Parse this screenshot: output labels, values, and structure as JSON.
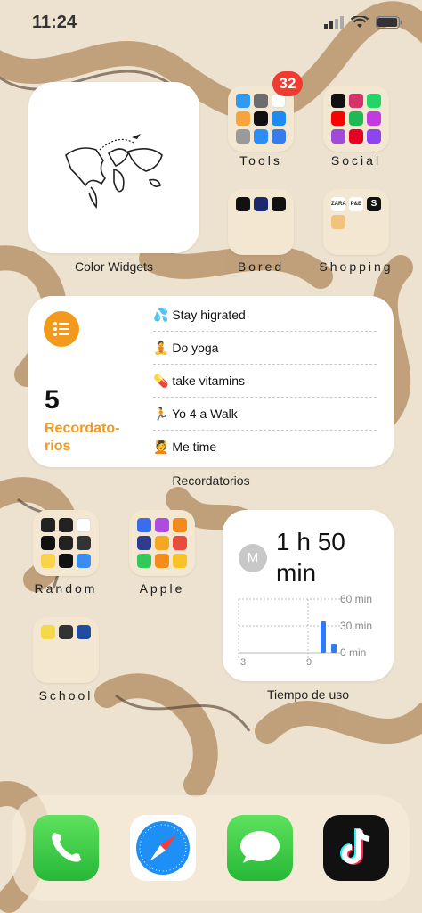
{
  "status": {
    "time": "11:24"
  },
  "widgets": {
    "color_widgets": {
      "label": "Color Widgets"
    },
    "reminders": {
      "count": "5",
      "title_line1": "Recordato-",
      "title_line2": "rios",
      "label": "Recordatorios",
      "items": [
        {
          "emoji": "💦",
          "text": "Stay higrated"
        },
        {
          "emoji": "🧘",
          "text": "Do yoga"
        },
        {
          "emoji": "💊",
          "text": "take vitamins"
        },
        {
          "emoji": "🏃",
          "text": "Yo 4 a Walk"
        },
        {
          "emoji": "💆",
          "text": "Me time"
        }
      ]
    },
    "screen_time": {
      "avatar": "M",
      "hours": "1 h 50",
      "minutes": "min",
      "label": "Tiempo de uso",
      "y_ticks": [
        "60 min",
        "30 min",
        "0 min"
      ],
      "x_ticks": [
        "3",
        "9"
      ],
      "bars_minutes": [
        35,
        10
      ],
      "accent": "#2f7cf6"
    }
  },
  "folders": {
    "tools": {
      "label": "Tools",
      "badge": "32"
    },
    "social": {
      "label": "Social"
    },
    "bored": {
      "label": "Bored"
    },
    "shopping": {
      "label": "Shopping",
      "zara": "ZARA",
      "pb": "P&B",
      "s": "S"
    },
    "random": {
      "label": "Random"
    },
    "apple": {
      "label": "Apple"
    },
    "school": {
      "label": "School"
    }
  },
  "dock": [
    {
      "name": "phone-icon"
    },
    {
      "name": "safari-icon"
    },
    {
      "name": "messages-icon"
    },
    {
      "name": "tiktok-icon"
    }
  ]
}
